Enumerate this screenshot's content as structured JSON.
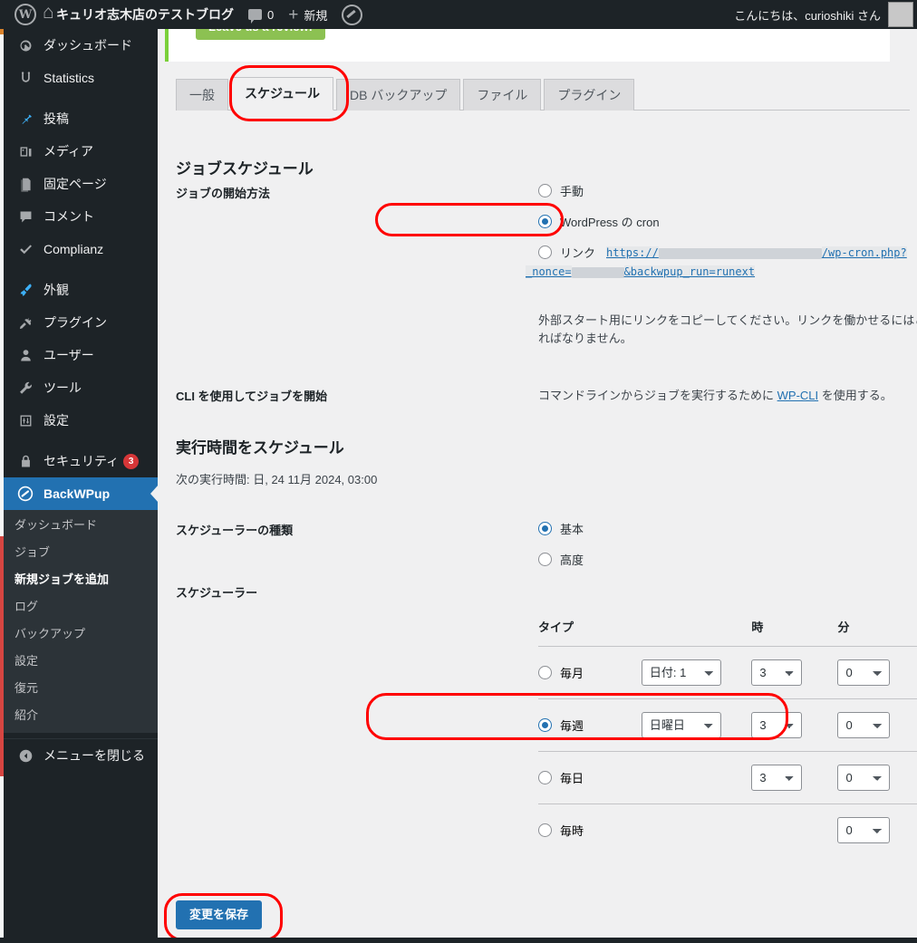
{
  "adminbar": {
    "logo_icon": "wordpress-logo-icon",
    "home_icon": "home-icon",
    "site_title": "キュリオ志木店のテストブログ",
    "comment_icon": "comment-bubble-icon",
    "comment_count": "0",
    "new_icon": "plus-icon",
    "new_label": "新規",
    "backwpup_icon": "backwpup-icon",
    "greeting": "こんにちは、curioshiki さん",
    "avatar": "user-avatar"
  },
  "sidebar": {
    "items": [
      {
        "label": "ダッシュボード",
        "icon": "dashboard-icon",
        "glyph": "◕"
      },
      {
        "label": "Statistics",
        "icon": "statistics-icon",
        "glyph": "☺"
      },
      {
        "label": "投稿",
        "icon": "pin-icon",
        "glyph": "📌"
      },
      {
        "label": "メディア",
        "icon": "media-icon",
        "glyph": "🖼"
      },
      {
        "label": "固定ページ",
        "icon": "page-icon",
        "glyph": "📄"
      },
      {
        "label": "コメント",
        "icon": "comment-icon",
        "glyph": "💬"
      },
      {
        "label": "Complianz",
        "icon": "check-icon",
        "glyph": "✔"
      },
      {
        "label": "外観",
        "icon": "appearance-brush-icon",
        "glyph": "🖌"
      },
      {
        "label": "プラグイン",
        "icon": "plugin-icon",
        "glyph": "🔌"
      },
      {
        "label": "ユーザー",
        "icon": "users-icon",
        "glyph": "👤"
      },
      {
        "label": "ツール",
        "icon": "tools-wrench-icon",
        "glyph": "🔧"
      },
      {
        "label": "設定",
        "icon": "settings-sliders-icon",
        "glyph": "🎚"
      },
      {
        "label": "セキュリティ",
        "icon": "lock-icon",
        "glyph": "🔒",
        "badge": "3"
      }
    ],
    "current": {
      "label": "BackWPup",
      "icon": "backwpup-icon"
    },
    "submenu": [
      {
        "label": "ダッシュボード",
        "current": false
      },
      {
        "label": "ジョブ",
        "current": false
      },
      {
        "label": "新規ジョブを追加",
        "current": true
      },
      {
        "label": "ログ",
        "current": false
      },
      {
        "label": "バックアップ",
        "current": false
      },
      {
        "label": "設定",
        "current": false
      },
      {
        "label": "復元",
        "current": false
      },
      {
        "label": "紹介",
        "current": false
      }
    ],
    "collapse": {
      "label": "メニューを閉じる",
      "icon": "collapse-arrow-icon"
    }
  },
  "notice": {
    "review_button": "Leave us a review!"
  },
  "tabs": [
    {
      "label": "一般",
      "active": false
    },
    {
      "label": "スケジュール",
      "active": true
    },
    {
      "label": "DB バックアップ",
      "active": false
    },
    {
      "label": "ファイル",
      "active": false
    },
    {
      "label": "プラグイン",
      "active": false
    }
  ],
  "headings": {
    "job_schedule": "ジョブスケジュール",
    "schedule_execution_time": "実行時間をスケジュール"
  },
  "start_method": {
    "label": "ジョブの開始方法",
    "options": [
      {
        "label": "手動",
        "checked": false
      },
      {
        "label": "WordPress の cron",
        "checked": true
      },
      {
        "label": "リンク",
        "checked": false
      }
    ],
    "link_prefix": "https://",
    "link_suffix": "/wp-cron.php?",
    "link_line2_a": "_nonce=",
    "link_line2_b": "&backwpup_run=runext",
    "help": "外部スタート用にリンクをコピーしてください。リンクを働かせるにはこのオプションが有効でなければなりません。"
  },
  "cli": {
    "label": "CLI を使用してジョブを開始",
    "text_before": "コマンドラインからジョブを実行するために ",
    "link": "WP-CLI",
    "text_after": " を使用する。"
  },
  "next_run": "次の実行時間: 日, 24 11月 2024, 03:00",
  "scheduler_type": {
    "label": "スケジューラーの種類",
    "options": [
      {
        "label": "基本",
        "checked": true
      },
      {
        "label": "高度",
        "checked": false
      }
    ]
  },
  "scheduler": {
    "label": "スケジューラー",
    "columns": {
      "type": "タイプ",
      "hour": "時",
      "minute": "分"
    },
    "rows": [
      {
        "type": "毎月",
        "checked": false,
        "day_select": "日付: 1",
        "hour_select": "3",
        "minute_select": "0",
        "has_day": true
      },
      {
        "type": "毎週",
        "checked": true,
        "day_select": "日曜日",
        "hour_select": "3",
        "minute_select": "0",
        "has_day": true
      },
      {
        "type": "毎日",
        "checked": false,
        "day_select": null,
        "hour_select": "3",
        "minute_select": "0",
        "has_day": false
      },
      {
        "type": "毎時",
        "checked": false,
        "day_select": null,
        "hour_select": null,
        "minute_select": "0",
        "has_day": false
      }
    ]
  },
  "save_button": "変更を保存",
  "colors": {
    "accent": "#2271b1",
    "sidebar_bg": "#1d2327",
    "submenu_bg": "#2c3338",
    "content_bg": "#f0f0f1",
    "annotation": "#ff0000",
    "badge": "#d63638",
    "review_green": "#8cc152"
  }
}
